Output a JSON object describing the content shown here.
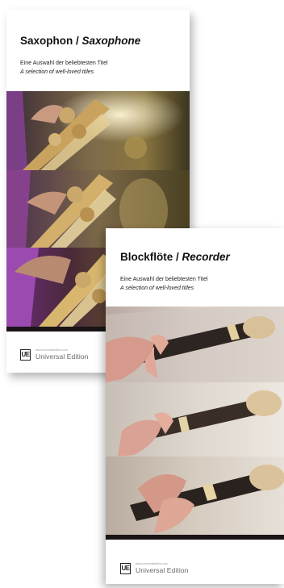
{
  "saxophone": {
    "title_de": "Saxophon",
    "title_sep": " / ",
    "title_en": "Saxophone",
    "subtitle_de": "Eine Auswahl der beliebtesten Titel",
    "subtitle_en": "A selection of well-loved titles",
    "logo_mark": "UE",
    "logo_url": "www.universaledition.com",
    "logo_name": "Universal Edition"
  },
  "recorder": {
    "title_de": "Blockflöte",
    "title_sep": " / ",
    "title_en": "Recorder",
    "subtitle_de": "Eine Auswahl der beliebtesten Titel",
    "subtitle_en": "A selection of well-loved titles",
    "logo_mark": "UE",
    "logo_url": "www.universaledition.com",
    "logo_name": "Universal Edition"
  }
}
